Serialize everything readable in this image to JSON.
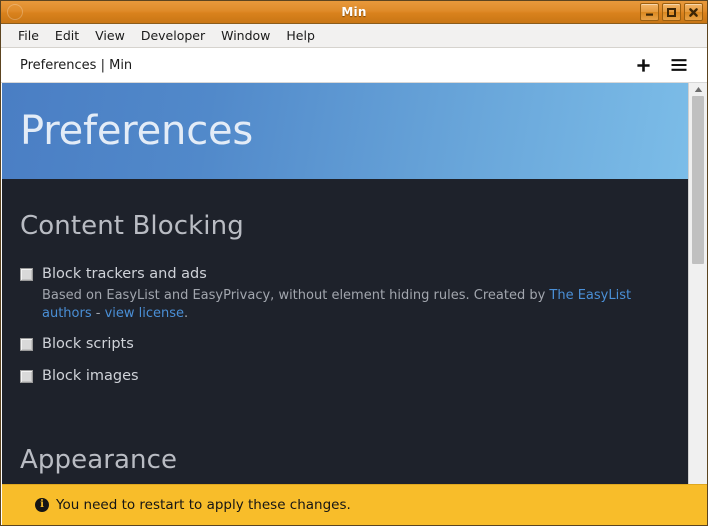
{
  "window": {
    "title": "Min",
    "app_icon": "circle-icon",
    "controls": [
      {
        "name": "minimize-button",
        "icon": "minimize-icon"
      },
      {
        "name": "maximize-button",
        "icon": "maximize-icon"
      },
      {
        "name": "close-button",
        "icon": "close-icon"
      }
    ]
  },
  "menubar": {
    "items": [
      {
        "label": "File"
      },
      {
        "label": "Edit"
      },
      {
        "label": "View"
      },
      {
        "label": "Developer"
      },
      {
        "label": "Window"
      },
      {
        "label": "Help"
      }
    ]
  },
  "tabstrip": {
    "tab_title": "Preferences | Min",
    "new_tab_icon": "plus-icon",
    "menu_icon": "hamburger-menu-icon"
  },
  "page": {
    "banner_title": "Preferences",
    "sections": [
      {
        "heading": "Content Blocking",
        "options": [
          {
            "label": "Block trackers and ads",
            "checked": false,
            "description_parts": [
              {
                "type": "text",
                "text": "Based on EasyList and EasyPrivacy, without element hiding rules. Created by "
              },
              {
                "type": "link",
                "text": "The EasyList authors"
              },
              {
                "type": "text",
                "text": " - "
              },
              {
                "type": "link",
                "text": "view license"
              },
              {
                "type": "text",
                "text": "."
              }
            ]
          },
          {
            "label": "Block scripts",
            "checked": false
          },
          {
            "label": "Block images",
            "checked": false
          }
        ]
      },
      {
        "heading": "Appearance",
        "options": []
      }
    ]
  },
  "notice": {
    "icon": "info-icon",
    "icon_glyph": "i",
    "text": "You need to restart to apply these changes."
  },
  "scrollbar": {
    "up_arrow_icon": "scroll-up-arrow-icon"
  },
  "colors": {
    "titlebar_accent": "#df8b29",
    "banner_left": "#4a7ec4",
    "banner_right": "#7cbde8",
    "page_background": "#1e222b",
    "link": "#4a8fd6",
    "notice_background": "#f8bd2a"
  }
}
